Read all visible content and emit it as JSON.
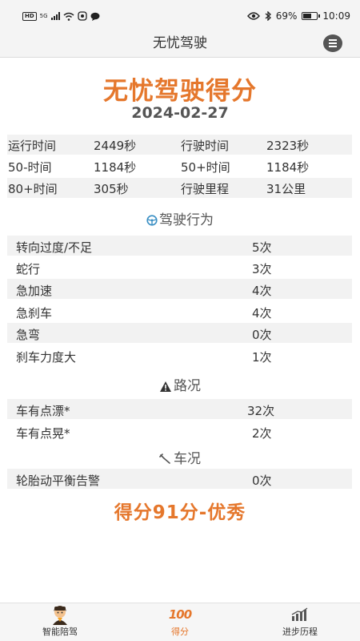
{
  "status_bar": {
    "hd": "HD",
    "network": "5G",
    "battery": "69%",
    "battery_level": 0.69,
    "time": "10:09"
  },
  "app_bar": {
    "title": "无忧驾驶"
  },
  "header": {
    "title": "无忧驾驶得分",
    "date": "2024-02-27"
  },
  "stats": [
    {
      "label1": "运行时间",
      "value1": "2449秒",
      "label2": "行驶时间",
      "value2": "2323秒"
    },
    {
      "label1": "50-时间",
      "value1": "1184秒",
      "label2": "50+时间",
      "value2": "1184秒"
    },
    {
      "label1": "80+时间",
      "value1": "305秒",
      "label2": "行驶里程",
      "value2": "31公里"
    }
  ],
  "sections": {
    "behavior": {
      "title": "驾驶行为",
      "icon": "steering-wheel-icon",
      "items": [
        {
          "label": "转向过度/不足",
          "count": "5次"
        },
        {
          "label": "蛇行",
          "count": "3次"
        },
        {
          "label": "急加速",
          "count": "4次"
        },
        {
          "label": "急刹车",
          "count": "4次"
        },
        {
          "label": "急弯",
          "count": "0次"
        },
        {
          "label": "刹车力度大",
          "count": "1次"
        }
      ]
    },
    "road": {
      "title": "路况",
      "icon": "warning-icon",
      "items": [
        {
          "label": "车有点漂*",
          "count": "32次"
        },
        {
          "label": "车有点晃*",
          "count": "2次"
        }
      ]
    },
    "vehicle": {
      "title": "车况",
      "icon": "wrench-icon",
      "items": [
        {
          "label": "轮胎动平衡告警",
          "count": "0次"
        }
      ]
    }
  },
  "final_score": "得分91分-优秀",
  "nav": {
    "items": [
      {
        "label": "智能陪驾",
        "icon": "avatar-icon"
      },
      {
        "label": "得分",
        "icon": "score-100-icon",
        "glyph": "100"
      },
      {
        "label": "进步历程",
        "icon": "progress-chart-icon"
      }
    ],
    "active_color": "#e5772c"
  },
  "colors": {
    "accent": "#e5772c",
    "row_alt": "#f2f2f2"
  }
}
